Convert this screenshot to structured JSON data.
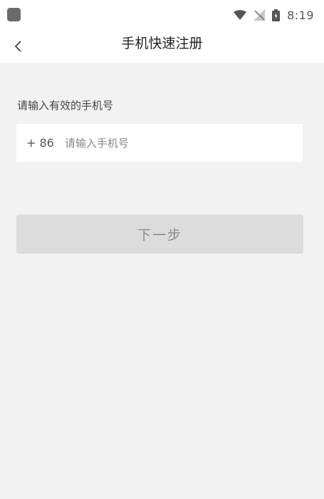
{
  "status_bar": {
    "time": "8:19",
    "icons": [
      "app-indicator-icon",
      "wifi-icon",
      "no-signal-icon",
      "battery-icon"
    ]
  },
  "nav": {
    "back_icon": "chevron-left-icon",
    "title": "手机快速注册"
  },
  "form": {
    "label": "请输入有效的手机号",
    "country_code": "+ 86",
    "phone_value": "",
    "phone_placeholder": "请输入手机号"
  },
  "actions": {
    "next_label": "下一步"
  },
  "colors": {
    "background": "#f2f2f2",
    "surface": "#ffffff",
    "button_disabled": "#dcdcdc",
    "button_text_disabled": "#8a8a8a"
  }
}
